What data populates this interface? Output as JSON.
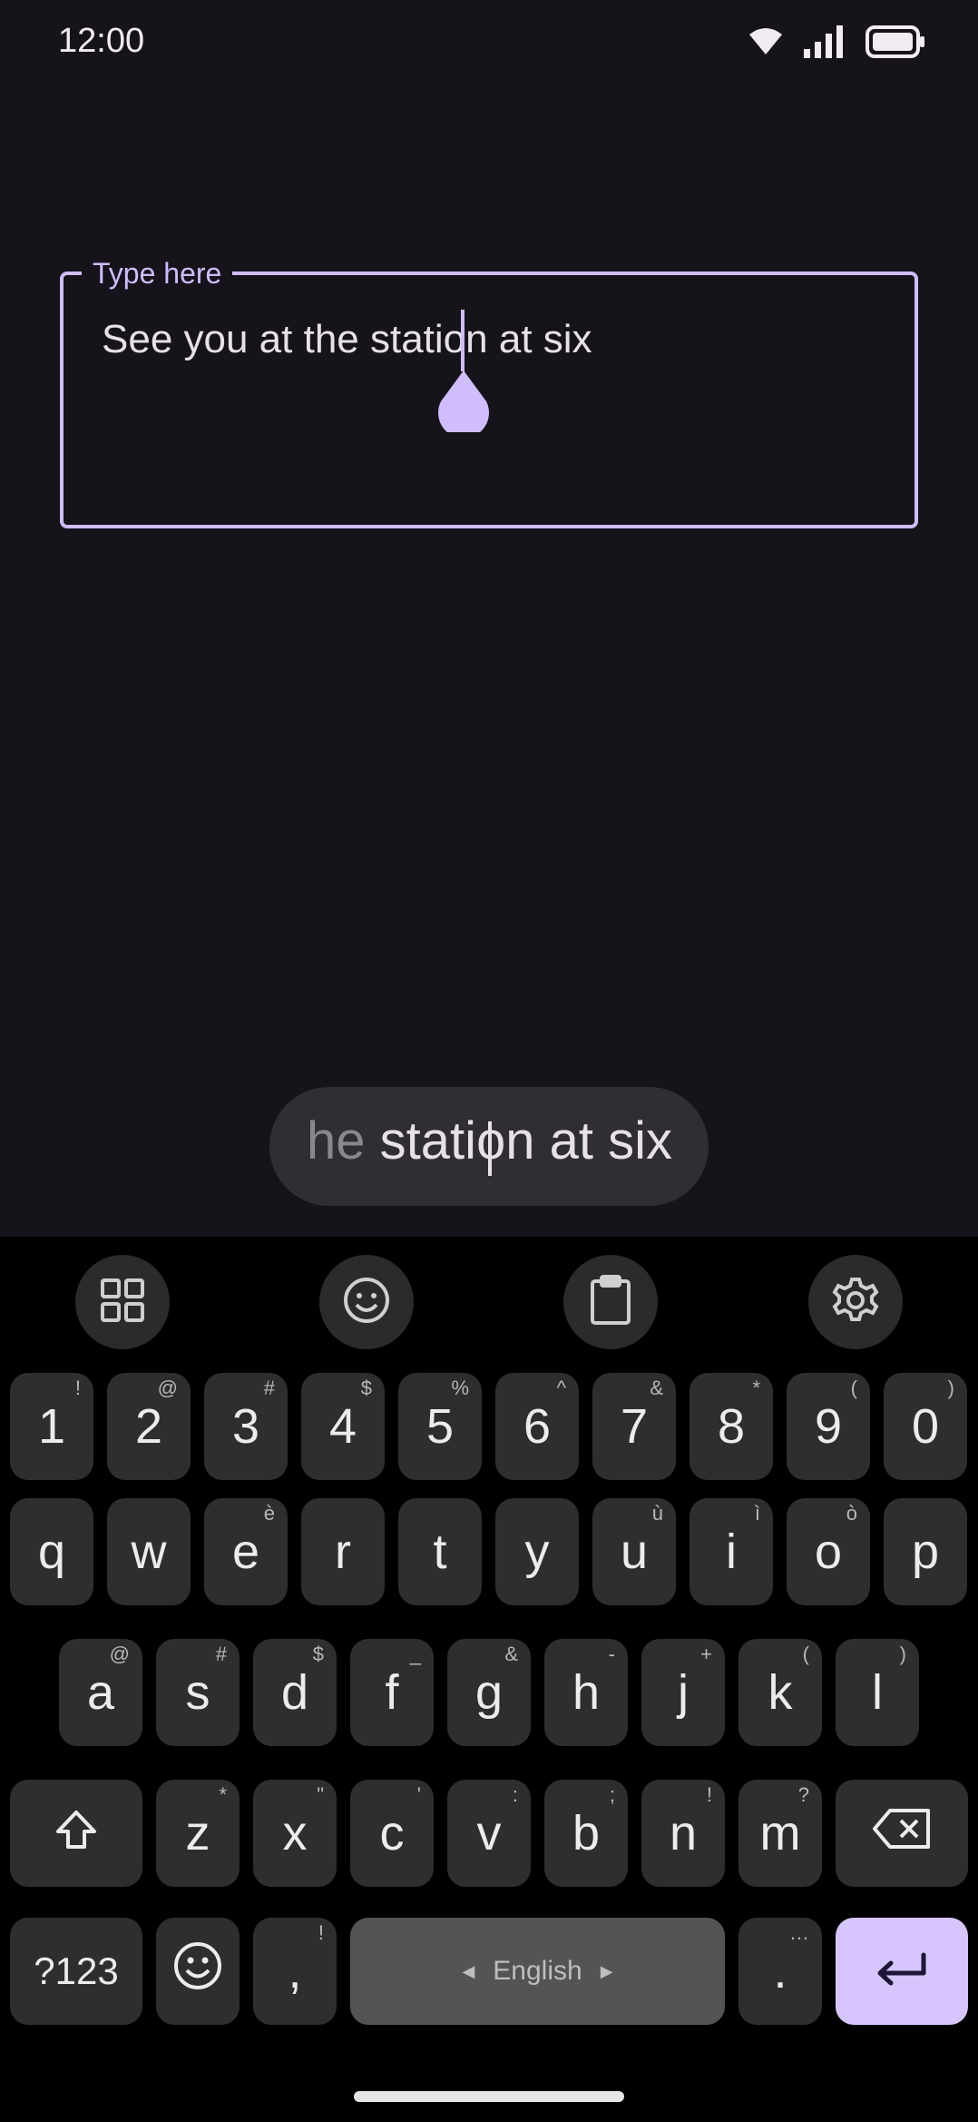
{
  "status_bar": {
    "time": "12:00"
  },
  "text_field": {
    "label": "Type here",
    "value": "See you at the station at six"
  },
  "magnifier": {
    "faded": "he",
    "text": " station at six"
  },
  "toolbar": [
    {
      "name": "apps-grid-icon"
    },
    {
      "name": "emoji-icon"
    },
    {
      "name": "clipboard-icon"
    },
    {
      "name": "settings-gear-icon"
    }
  ],
  "keyboard": {
    "number_row": [
      {
        "key": "1",
        "hint": "!"
      },
      {
        "key": "2",
        "hint": "@"
      },
      {
        "key": "3",
        "hint": "#"
      },
      {
        "key": "4",
        "hint": "$"
      },
      {
        "key": "5",
        "hint": "%"
      },
      {
        "key": "6",
        "hint": "^"
      },
      {
        "key": "7",
        "hint": "&"
      },
      {
        "key": "8",
        "hint": "*"
      },
      {
        "key": "9",
        "hint": "("
      },
      {
        "key": "0",
        "hint": ")"
      }
    ],
    "row1": [
      {
        "key": "q",
        "hint": ""
      },
      {
        "key": "w",
        "hint": ""
      },
      {
        "key": "e",
        "hint": "è"
      },
      {
        "key": "r",
        "hint": ""
      },
      {
        "key": "t",
        "hint": ""
      },
      {
        "key": "y",
        "hint": ""
      },
      {
        "key": "u",
        "hint": "ù"
      },
      {
        "key": "i",
        "hint": "ì"
      },
      {
        "key": "o",
        "hint": "ò"
      },
      {
        "key": "p",
        "hint": ""
      }
    ],
    "row2": [
      {
        "key": "a",
        "hint": "@"
      },
      {
        "key": "s",
        "hint": "#"
      },
      {
        "key": "d",
        "hint": "$"
      },
      {
        "key": "f",
        "hint": "_"
      },
      {
        "key": "g",
        "hint": "&"
      },
      {
        "key": "h",
        "hint": "-"
      },
      {
        "key": "j",
        "hint": "+"
      },
      {
        "key": "k",
        "hint": "("
      },
      {
        "key": "l",
        "hint": ")"
      }
    ],
    "row3": [
      {
        "key": "z",
        "hint": "*"
      },
      {
        "key": "x",
        "hint": "\""
      },
      {
        "key": "c",
        "hint": "'"
      },
      {
        "key": "v",
        "hint": ":"
      },
      {
        "key": "b",
        "hint": ";"
      },
      {
        "key": "n",
        "hint": "!"
      },
      {
        "key": "m",
        "hint": "?"
      }
    ],
    "symbols_label": "?123",
    "comma": {
      "key": ",",
      "hint": "!"
    },
    "space_label": "English",
    "period": {
      "key": ".",
      "hint": "…"
    }
  },
  "colors": {
    "accent": "#cfbdfe",
    "background": "#16131b",
    "key": "#2e2e2e",
    "enter_key": "#d7c6fd"
  }
}
